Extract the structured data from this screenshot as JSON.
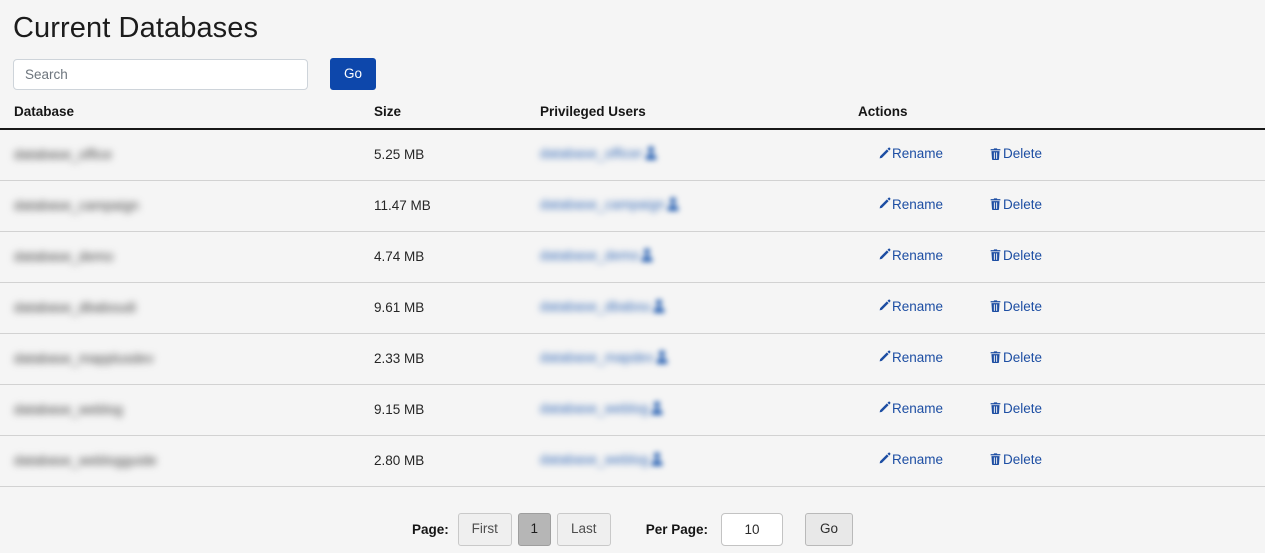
{
  "page_title": "Current Databases",
  "search": {
    "placeholder": "Search",
    "value": "",
    "go_label": "Go"
  },
  "table": {
    "columns": {
      "database": "Database",
      "size": "Size",
      "privileged_users": "Privileged Users",
      "actions": "Actions"
    },
    "rename_label": "Rename",
    "delete_label": "Delete",
    "rows": [
      {
        "database": "database_office",
        "size": "5.25 MB",
        "privileged_user": "database_officer"
      },
      {
        "database": "database_campaign",
        "size": "11.47 MB",
        "privileged_user": "database_campaign"
      },
      {
        "database": "database_demo",
        "size": "4.74 MB",
        "privileged_user": "database_demo"
      },
      {
        "database": "database_dbaboudi",
        "size": "9.61 MB",
        "privileged_user": "database_dbabou"
      },
      {
        "database": "database_mapplusdev",
        "size": "2.33 MB",
        "privileged_user": "database_mapdev"
      },
      {
        "database": "database_weblog",
        "size": "9.15 MB",
        "privileged_user": "database_weblog"
      },
      {
        "database": "database_weblogguide",
        "size": "2.80 MB",
        "privileged_user": "database_weblog"
      }
    ]
  },
  "footer": {
    "page_label": "Page:",
    "first_label": "First",
    "current_page": "1",
    "last_label": "Last",
    "per_page_label": "Per Page:",
    "per_page_value": "10",
    "go_label": "Go"
  },
  "colors": {
    "primary_blue": "#0d47ab",
    "link_blue": "#1d4ea3",
    "background": "#f5f5f5",
    "header_border": "#181818",
    "row_border": "#d2d2d2",
    "active_page": "#b6b6b6"
  }
}
